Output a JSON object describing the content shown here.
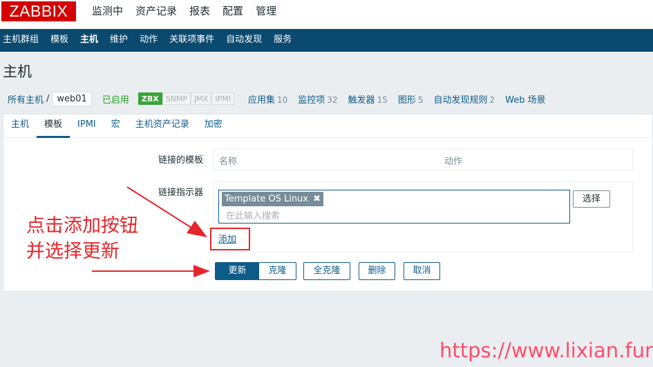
{
  "logo": "ZABBIX",
  "top_menu": [
    "监测中",
    "资产记录",
    "报表",
    "配置",
    "管理"
  ],
  "sub_menu": [
    "主机群组",
    "模板",
    "主机",
    "维护",
    "动作",
    "关联项事件",
    "自动发现",
    "服务"
  ],
  "page_title": "主机",
  "breadcrumb": {
    "all_hosts": "所有主机",
    "separator": "/",
    "host": "web01",
    "status": "已启用",
    "badges": [
      "ZBX",
      "SNMP",
      "JMX",
      "IPMI"
    ],
    "items": [
      {
        "label": "应用集",
        "count": "10"
      },
      {
        "label": "监控项",
        "count": "32"
      },
      {
        "label": "触发器",
        "count": "15"
      },
      {
        "label": "图形",
        "count": "5"
      },
      {
        "label": "自动发现规则",
        "count": "2"
      },
      {
        "label": "Web 场景",
        "count": ""
      }
    ]
  },
  "tabs": [
    "主机",
    "模板",
    "IPMI",
    "宏",
    "主机资产记录",
    "加密"
  ],
  "form": {
    "linked_templates_label": "链接的模板",
    "col_name": "名称",
    "col_action": "动作",
    "link_indicator_label": "链接指示器",
    "selected_template": "Template OS Linux",
    "search_placeholder": "在此输入搜索",
    "select_button": "选择",
    "add_link": "添加"
  },
  "buttons": {
    "update": "更新",
    "clone": "克隆",
    "full_clone": "全克隆",
    "delete": "删除",
    "cancel": "取消"
  },
  "annotation": {
    "line1": "点击添加按钮",
    "line2": "并选择更新",
    "color": "#e5262b"
  },
  "watermark": "https://www.lixian.fun",
  "colors": {
    "brand": "#d40000",
    "nav": "#0b4a6f",
    "link": "#0d5b89",
    "enabled": "#299f29"
  }
}
